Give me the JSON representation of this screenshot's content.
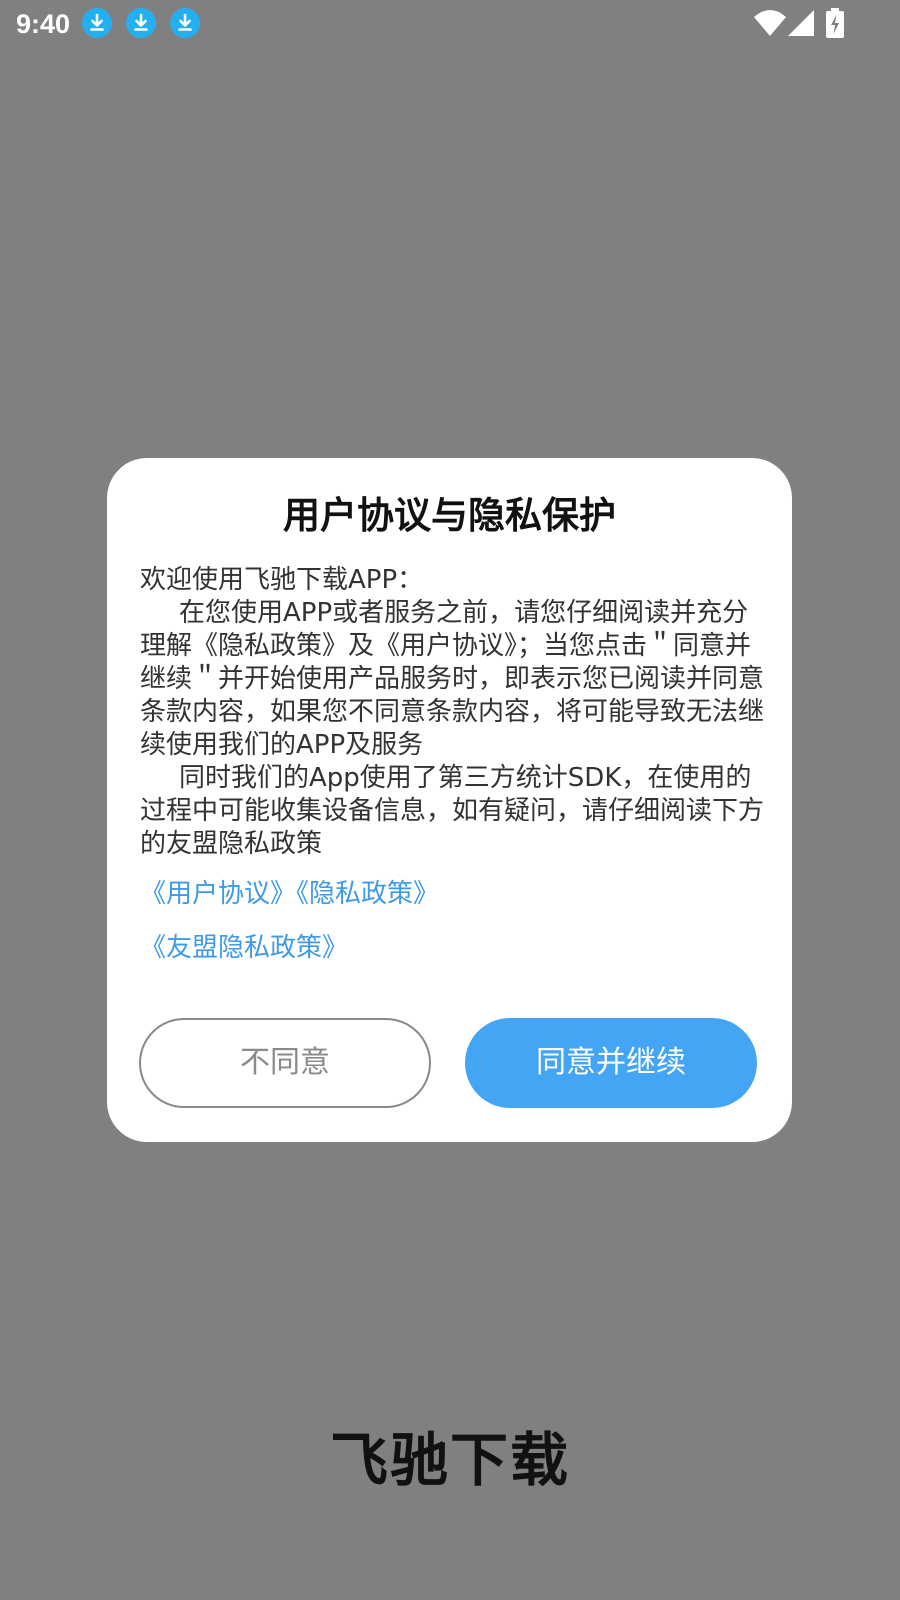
{
  "status_bar": {
    "time": "9:40",
    "notifications": [
      "download-icon",
      "download-icon",
      "download-icon"
    ],
    "indicators": [
      "wifi-icon",
      "cellular-signal-icon",
      "battery-charging-icon"
    ]
  },
  "dialog": {
    "title": "用户协议与隐私保护",
    "intro": "欢迎使用飞驰下载APP：",
    "paragraph1": "在您使用APP或者服务之前，请您仔细阅读并充分理解《隐私政策》及《用户协议》；当您点击＂同意并继续＂并开始使用产品服务时，即表示您已阅读并同意条款内容，如果您不同意条款内容，将可能导致无法继续使用我们的APP及服务",
    "paragraph2": "同时我们的App使用了第三方统计SDK，在使用的过程中可能收集设备信息，如有疑问，请仔细阅读下方的友盟隐私政策",
    "link_user_agreement": "《用户协议》",
    "link_privacy_policy": "《隐私政策》",
    "link_umeng_privacy": "《友盟隐私政策》",
    "disagree_label": "不同意",
    "agree_label": "同意并继续"
  },
  "brand": {
    "app_name": "飞驰下载"
  },
  "colors": {
    "overlay": "#808080",
    "link": "#3f9ae8",
    "primary_button": "#45a5f5",
    "notification_icon": "#24b0f0"
  }
}
